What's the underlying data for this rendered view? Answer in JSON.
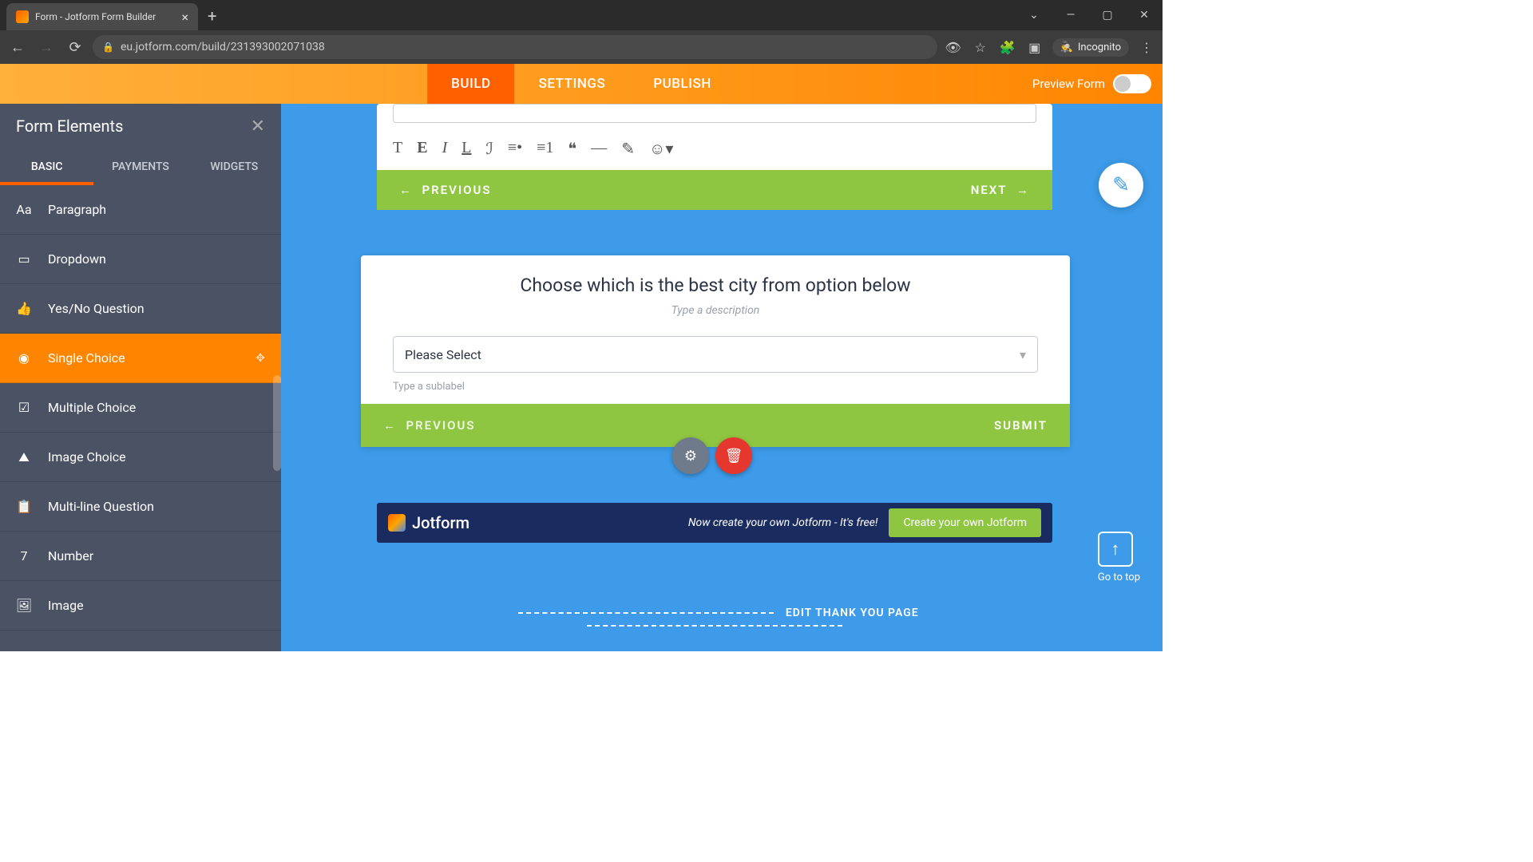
{
  "browser": {
    "tab_title": "Form - Jotform Form Builder",
    "url": "eu.jotform.com/build/231393002071038",
    "incognito_label": "Incognito"
  },
  "header": {
    "tabs": {
      "build": "BUILD",
      "settings": "SETTINGS",
      "publish": "PUBLISH"
    },
    "preview_label": "Preview Form"
  },
  "sidebar": {
    "title": "Form Elements",
    "tabs": {
      "basic": "BASIC",
      "payments": "PAYMENTS",
      "widgets": "WIDGETS"
    },
    "items": [
      {
        "label": "Paragraph",
        "icon": "Aa"
      },
      {
        "label": "Dropdown",
        "icon": "▭"
      },
      {
        "label": "Yes/No Question",
        "icon": "👍"
      },
      {
        "label": "Single Choice",
        "icon": "◉",
        "active": true
      },
      {
        "label": "Multiple Choice",
        "icon": "☑"
      },
      {
        "label": "Image Choice",
        "icon": "⛰"
      },
      {
        "label": "Multi-line Question",
        "icon": "📋"
      },
      {
        "label": "Number",
        "icon": "7"
      },
      {
        "label": "Image",
        "icon": "🖼"
      }
    ]
  },
  "card1": {
    "prev": "PREVIOUS",
    "next": "NEXT"
  },
  "card2": {
    "title": "Choose which is the best city from option below",
    "desc_placeholder": "Type a description",
    "select_placeholder": "Please Select",
    "sublabel_placeholder": "Type a sublabel",
    "prev": "PREVIOUS",
    "submit": "SUBMIT"
  },
  "promo": {
    "brand": "Jotform",
    "text": "Now create your own Jotform - It's free!",
    "cta": "Create your own Jotform"
  },
  "gotop": "Go to top",
  "editthank": "EDIT THANK YOU PAGE"
}
